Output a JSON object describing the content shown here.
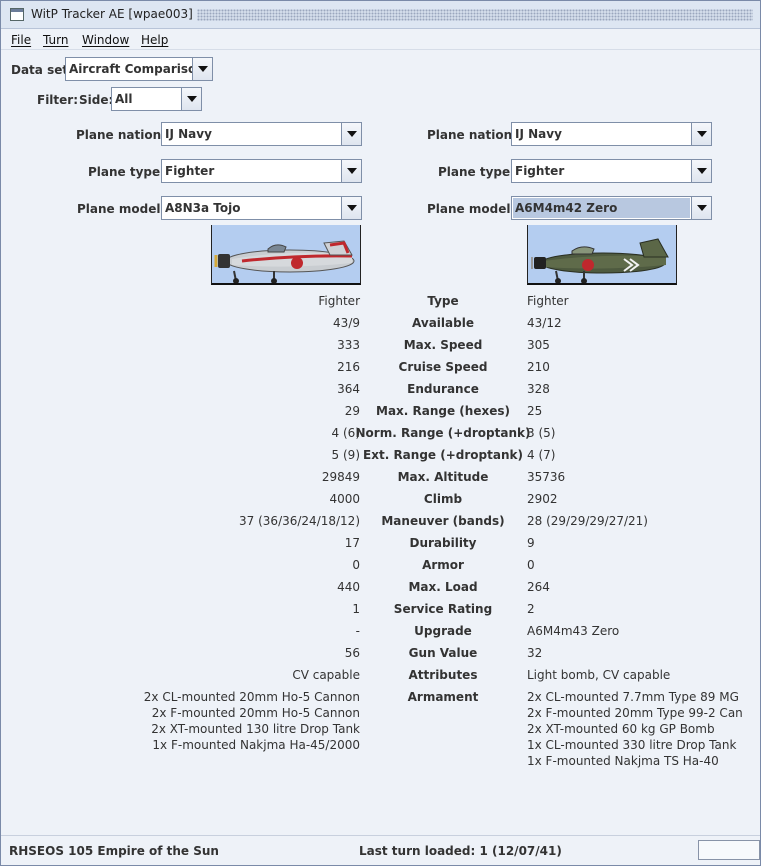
{
  "window": {
    "title": "WitP Tracker AE [wpae003]"
  },
  "menu": [
    {
      "label": "File"
    },
    {
      "label": "Turn"
    },
    {
      "label": "Window"
    },
    {
      "label": "Help"
    }
  ],
  "dataset": {
    "label": "Data set:",
    "value": "Aircraft Comparison"
  },
  "filter": {
    "label": "Filter:",
    "side_label": "Side:",
    "side_value": "All"
  },
  "left": {
    "nation_label": "Plane nation:",
    "nation": "IJ Navy",
    "type_label": "Plane type:",
    "type": "Fighter",
    "model_label": "Plane model:",
    "model": "A8N3a Tojo"
  },
  "right": {
    "nation_label": "Plane nation:",
    "nation": "IJ Navy",
    "type_label": "Plane type:",
    "type": "Fighter",
    "model_label": "Plane model:",
    "model": "A6M4m42 Zero"
  },
  "stats": [
    {
      "name": "Type",
      "left": "Fighter",
      "right": "Fighter"
    },
    {
      "name": "Available",
      "left": "43/9",
      "right": "43/12"
    },
    {
      "name": "Max. Speed",
      "left": "333",
      "right": "305"
    },
    {
      "name": "Cruise Speed",
      "left": "216",
      "right": "210"
    },
    {
      "name": "Endurance",
      "left": "364",
      "right": "328"
    },
    {
      "name": "Max. Range (hexes)",
      "left": "29",
      "right": "25"
    },
    {
      "name": "Norm. Range (+droptank)",
      "left": "4 (6)",
      "right": "3 (5)"
    },
    {
      "name": "Ext. Range (+droptank)",
      "left": "5 (9)",
      "right": "4 (7)"
    },
    {
      "name": "Max. Altitude",
      "left": "29849",
      "right": "35736"
    },
    {
      "name": "Climb",
      "left": "4000",
      "right": "2902"
    },
    {
      "name": "Maneuver (bands)",
      "left": "37 (36/36/24/18/12)",
      "right": "28 (29/29/29/27/21)"
    },
    {
      "name": "Durability",
      "left": "17",
      "right": "9"
    },
    {
      "name": "Armor",
      "left": "0",
      "right": "0"
    },
    {
      "name": "Max. Load",
      "left": "440",
      "right": "264"
    },
    {
      "name": "Service Rating",
      "left": "1",
      "right": "2"
    },
    {
      "name": "Upgrade",
      "left": "-",
      "right": "A6M4m43 Zero"
    },
    {
      "name": "Gun Value",
      "left": "56",
      "right": "32"
    },
    {
      "name": "Attributes",
      "left": "CV capable",
      "right": "Light bomb, CV capable"
    }
  ],
  "armament": {
    "name": "Armament",
    "left": [
      "2x CL-mounted 20mm Ho-5 Cannon",
      "2x F-mounted 20mm Ho-5 Cannon",
      "2x XT-mounted 130 litre Drop Tank",
      "1x F-mounted Nakjma Ha-45/2000"
    ],
    "right": [
      "2x CL-mounted 7.7mm Type 89 MG",
      "2x F-mounted 20mm Type 99-2 Can",
      "2x XT-mounted 60 kg GP Bomb",
      "1x CL-mounted 330 litre Drop Tank",
      "1x F-mounted Nakjma TS Ha-40"
    ]
  },
  "status": {
    "scenario": "RHSEOS 105 Empire of the Sun",
    "last_turn": "Last turn loaded: 1 (12/07/41)"
  }
}
